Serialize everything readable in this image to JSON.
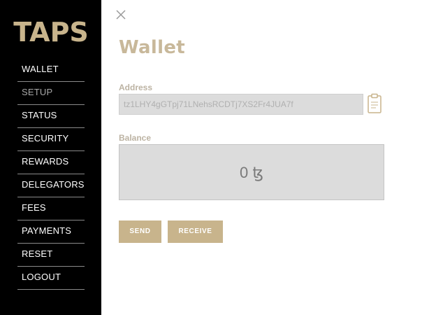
{
  "app": {
    "logo_text": "TAPS"
  },
  "sidebar": {
    "items": [
      {
        "label": "WALLET"
      },
      {
        "label": "SETUP"
      },
      {
        "label": "STATUS"
      },
      {
        "label": "SECURITY"
      },
      {
        "label": "REWARDS"
      },
      {
        "label": "DELEGATORS"
      },
      {
        "label": "FEES"
      },
      {
        "label": "PAYMENTS"
      },
      {
        "label": "RESET"
      },
      {
        "label": "LOGOUT"
      }
    ]
  },
  "main": {
    "title": "Wallet",
    "address": {
      "label": "Address",
      "value": "tz1LHY4gGTpj71LNehsRCDTj7XS2Fr4JUA7f"
    },
    "balance": {
      "label": "Balance",
      "value": "0 ꜩ"
    },
    "buttons": {
      "send": "SEND",
      "receive": "RECEIVE"
    }
  },
  "colors": {
    "sidebar_bg": "#000000",
    "accent_gold": "#c8b48c",
    "title_color": "#c8b89a",
    "input_bg": "#dcdcdc"
  },
  "icons": {
    "close": "close-icon",
    "clipboard": "clipboard-icon"
  }
}
